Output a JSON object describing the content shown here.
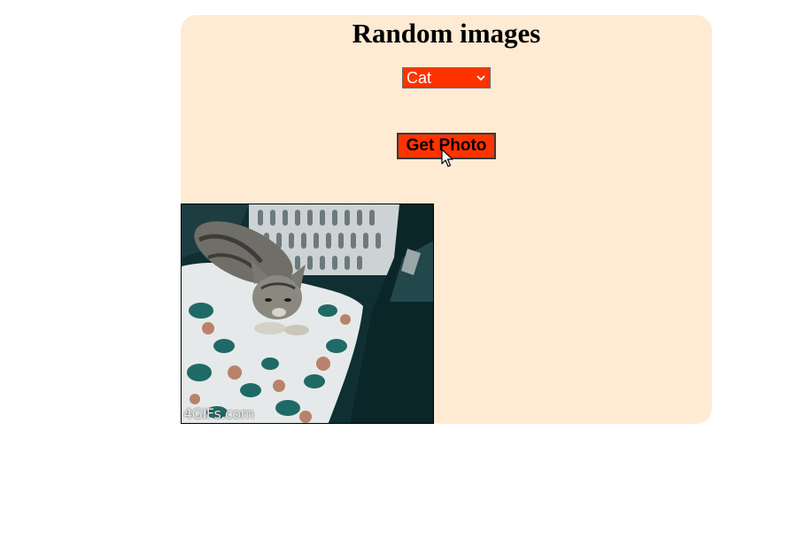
{
  "page": {
    "title": "Random images"
  },
  "controls": {
    "category_select": {
      "selected": "Cat",
      "background": "#ff3300"
    },
    "get_photo_label": "Get Photo"
  },
  "photo": {
    "subject": "kitten on floral cushion",
    "watermark": "4GIFs.com"
  },
  "colors": {
    "card_background": "#ffebd3",
    "accent": "#ff3300"
  }
}
